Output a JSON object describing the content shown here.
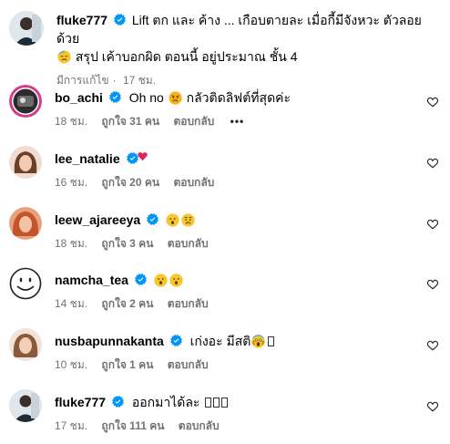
{
  "caption": {
    "username": "fluke777",
    "text_line1": "Lift ตก และ ค้าง ... เกือบตายละ เมื่อกี้มีจังหวะ ตัวลอยด้วย",
    "text_line2": "สรุป เค้าบอกผิด ตอนนี้ อยู่ประมาณ ชั้น 4",
    "edited_label": "มีการแก้ไข",
    "separator": "·",
    "time": "17 ชม."
  },
  "comments": [
    {
      "username": "bo_achi",
      "text_before": "Oh no",
      "text_after": "กลัวติดลิฟต์ที่สุดค่ะ",
      "emojis": [
        "angry-face"
      ],
      "time": "18 ชม.",
      "likes": "ถูกใจ 31 คน",
      "reply": "ตอบกลับ",
      "more": "•••"
    },
    {
      "username": "lee_natalie",
      "text_before": "",
      "text_after": "",
      "emojis": [],
      "time": "16 ชม.",
      "likes": "ถูกใจ 20 คน",
      "reply": "ตอบกลับ"
    },
    {
      "username": "leew_ajareeya",
      "text_before": "",
      "text_after": "",
      "emojis": [
        "surprised-face",
        "worried-face"
      ],
      "time": "18 ชม.",
      "likes": "ถูกใจ 3 คน",
      "reply": "ตอบกลับ"
    },
    {
      "username": "namcha_tea",
      "text_before": "",
      "text_after": "",
      "emojis": [
        "surprised-face",
        "surprised-face"
      ],
      "time": "14 ชม.",
      "likes": "ถูกใจ 2 คน",
      "reply": "ตอบกลับ"
    },
    {
      "username": "nusbapunnakanta",
      "text_before": "เก่งอะ มีสติ",
      "text_after": "",
      "emojis": [
        "screaming-face"
      ],
      "time": "10 ชม.",
      "likes": "ถูกใจ 1 คน",
      "reply": "ตอบกลับ"
    },
    {
      "username": "fluke777",
      "text_before": "ออกมาได้ละ",
      "text_after": "",
      "emojis": [],
      "time": "17 ชม.",
      "likes": "ถูกใจ 111 คน",
      "reply": "ตอบกลับ"
    }
  ],
  "icons": {
    "verified": "verified-badge-icon",
    "like": "heart-outline-icon"
  },
  "colors": {
    "verified_blue": "#0095f6",
    "meta_gray": "#737373",
    "heart_red": "#ed4956"
  }
}
